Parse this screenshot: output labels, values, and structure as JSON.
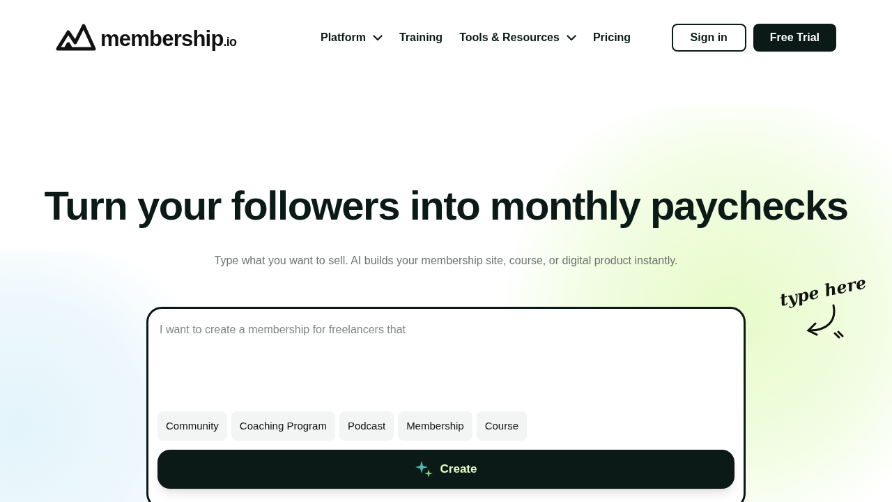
{
  "logo": {
    "name": "membership",
    "suffix": ".io"
  },
  "nav": [
    {
      "label": "Platform",
      "has_menu": true
    },
    {
      "label": "Training",
      "has_menu": false
    },
    {
      "label": "Tools & Resources",
      "has_menu": true
    },
    {
      "label": "Pricing",
      "has_menu": false
    }
  ],
  "actions": [
    {
      "label": "Sign in",
      "kind": "outline"
    },
    {
      "label": "Free Trial",
      "kind": "solid"
    }
  ],
  "hero": {
    "title": "Turn your followers into monthly paychecks",
    "subtitle": "Type what you want to sell. AI builds your membership site, course, or digital product instantly.",
    "hint": "type here"
  },
  "prompt": {
    "placeholder": "I want to create a membership for freelancers that",
    "chips": [
      "Community",
      "Coaching Program",
      "Podcast",
      "Membership",
      "Course"
    ],
    "button": "Create"
  }
}
